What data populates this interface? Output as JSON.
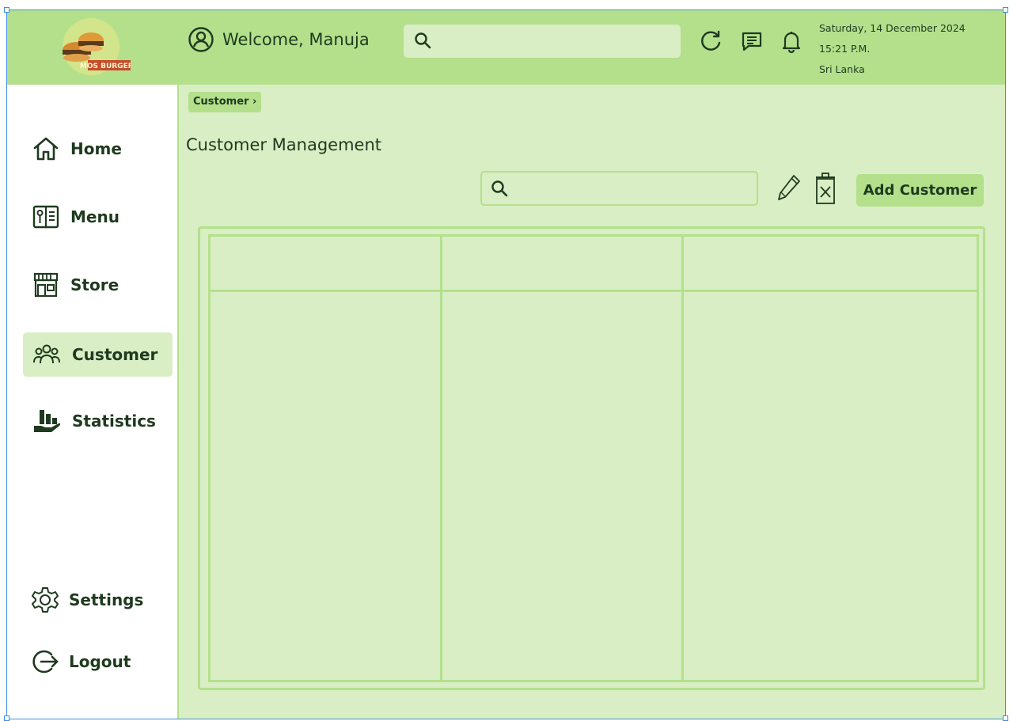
{
  "header": {
    "logo_text": "MOS BURGERS",
    "welcome_text": "Welcome, Manuja",
    "search_placeholder": "",
    "date": "Saturday, 14 December 2024",
    "time": "15:21 P.M.",
    "location": "Sri Lanka",
    "icons": [
      "user-circle-icon",
      "search-icon",
      "refresh-icon",
      "message-icon",
      "bell-icon"
    ]
  },
  "sidebar": {
    "items": [
      {
        "label": "Home",
        "icon": "home-icon"
      },
      {
        "label": "Menu",
        "icon": "menu-book-icon"
      },
      {
        "label": "Store",
        "icon": "store-icon"
      },
      {
        "label": "Customer",
        "icon": "users-icon",
        "active": true
      },
      {
        "label": "Statistics",
        "icon": "statistics-icon"
      }
    ],
    "bottom_items": [
      {
        "label": "Settings",
        "icon": "gear-icon"
      },
      {
        "label": "Logout",
        "icon": "logout-icon"
      }
    ]
  },
  "main": {
    "breadcrumb": "Customer ›",
    "title": "Customer Management",
    "search_placeholder": "",
    "add_button_label": "Add Customer",
    "table": {
      "headers": [
        "",
        "",
        ""
      ],
      "rows": [
        [
          "",
          "",
          ""
        ]
      ]
    }
  },
  "colors": {
    "accent": "#b4e08c",
    "background": "#d9eec4",
    "text": "#1f3a1f",
    "sidebar_bg": "#ffffff"
  }
}
